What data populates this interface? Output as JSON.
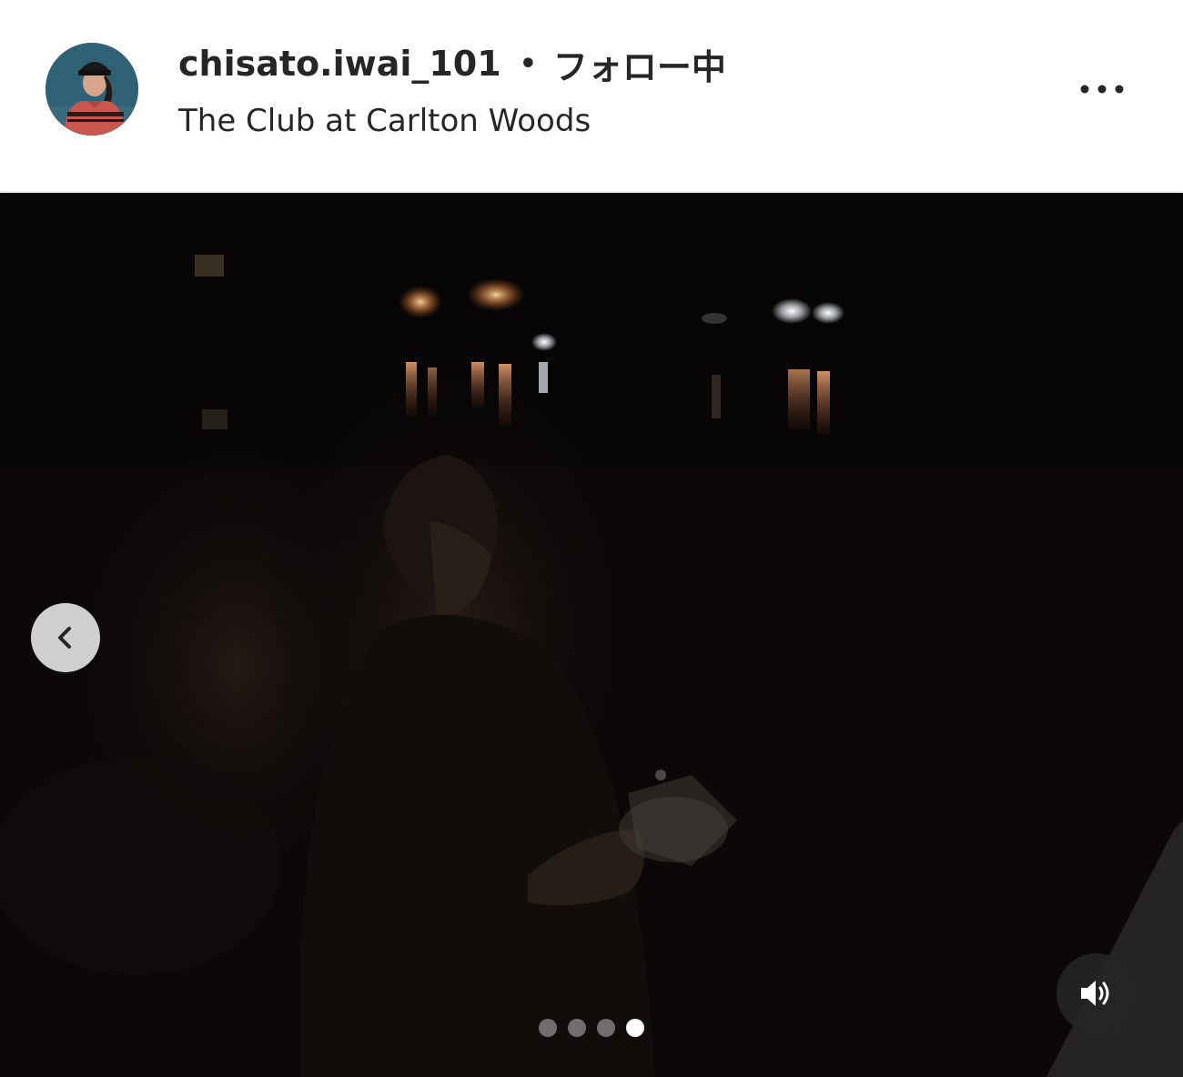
{
  "header": {
    "username": "chisato.iwai_101",
    "separator": "•",
    "follow_status": "フォロー中",
    "location": "The Club at Carlton Woods",
    "avatar_icon": "avatar-photo",
    "more_icon": "more-horizontal-icon"
  },
  "media": {
    "prev_icon": "chevron-left-icon",
    "sound_icon": "speaker-volume-icon",
    "carousel": {
      "total": 4,
      "active_index": 4
    }
  },
  "colors": {
    "text": "#262626",
    "media_bg": "#080606",
    "dot_active": "#ffffff",
    "dot_inactive": "rgba(255,255,255,0.4)"
  }
}
